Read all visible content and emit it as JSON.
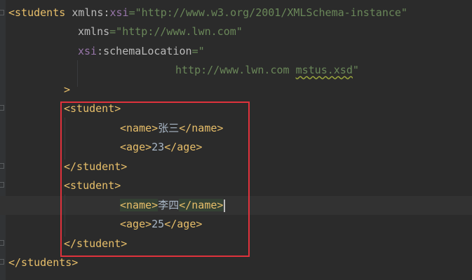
{
  "code": {
    "line1": {
      "tag_open": "<students",
      "sp1": " ",
      "attr_xmlns": "xmlns",
      "colon": ":",
      "ns_xsi": "xsi",
      "eq_q": "=\"",
      "value": "http://www.w3.org/2001/XMLSchema-instance",
      "close_q": "\""
    },
    "line2": {
      "attr_xmlns": "xmlns",
      "eq_q": "=\"",
      "value": "http://www.lwn.com",
      "close_q": "\""
    },
    "line3": {
      "ns_xsi": "xsi",
      "colon": ":",
      "attr": "schemaLocation",
      "eq_q": "=\""
    },
    "line4": {
      "value_a": "http://www.lwn.com ",
      "value_b": "mstus.xsd",
      "close_q": "\""
    },
    "line5": {
      "close": ">"
    },
    "line6": {
      "tag": "<student>"
    },
    "line7": {
      "open": "<name>",
      "text": "张三",
      "close": "</name>"
    },
    "line8": {
      "open": "<age>",
      "text": "23",
      "close": "</age>"
    },
    "line9": {
      "tag": "</student>"
    },
    "line10": {
      "tag": "<student>"
    },
    "line11": {
      "open_lt": "<",
      "open_rest": "name>",
      "text": "李四",
      "close_a": "</name",
      "close_b": ">"
    },
    "line12": {
      "open": "<age>",
      "text": "25",
      "close": "</age>"
    },
    "line13": {
      "tag": "</student>"
    },
    "line14": {
      "tag": "</students>"
    }
  },
  "colors": {
    "background": "#2b2b2b",
    "tag": "#e8bf6a",
    "attribute": "#bababa",
    "namespace": "#9876aa",
    "string": "#6a8759",
    "text": "#a9b7c6",
    "highlight_box": "#e0323c",
    "caret_line": "#323232"
  }
}
